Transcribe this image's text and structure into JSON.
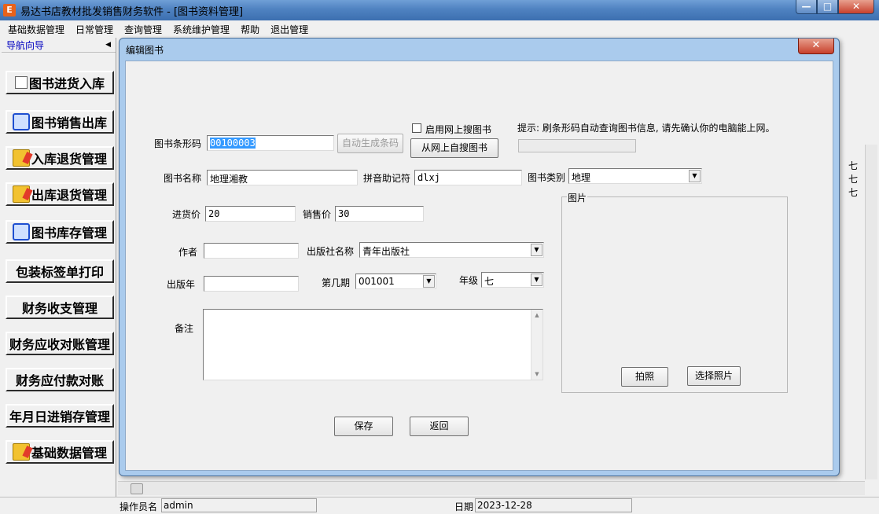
{
  "window": {
    "title": "易达书店教材批发销售财务软件    - [图书资料管理]",
    "app_icon": "e-icon"
  },
  "menubar": [
    "基础数据管理",
    "日常管理",
    "查询管理",
    "系统维护管理",
    "帮助",
    "退出管理"
  ],
  "sidebar": {
    "header": "导航向导",
    "items": [
      {
        "label": "图书进货入库",
        "icon": "cart-icon"
      },
      {
        "label": "图书销售出库",
        "icon": "arrows-icon"
      },
      {
        "label": "入库退货管理",
        "icon": "folder-icon"
      },
      {
        "label": "出库退货管理",
        "icon": "folder-icon"
      },
      {
        "label": "图书库存管理",
        "icon": "arrows-icon"
      },
      {
        "label": "包装标签单打印",
        "icon": ""
      },
      {
        "label": "财务收支管理",
        "icon": ""
      },
      {
        "label": "财务应收对账管理",
        "icon": ""
      },
      {
        "label": "财务应付款对账",
        "icon": ""
      },
      {
        "label": "年月日进销存管理",
        "icon": ""
      },
      {
        "label": "基础数据管理",
        "icon": "folder-icon"
      }
    ]
  },
  "background_grid": {
    "cells": [
      "七",
      "七",
      "七"
    ]
  },
  "dialog": {
    "title": "编辑图书",
    "barcode_label": "图书条形码",
    "barcode_value": "00100003",
    "auto_barcode_button": "自动生成条码",
    "online_search_checkbox": "启用网上搜图书",
    "online_search_checked": false,
    "online_search_button": "从网上自搜图书",
    "hint": "提示: 刷条形码自动查询图书信息, 请先确认你的电脑能上网。",
    "name_label": "图书名称",
    "name_value": "地理湘教",
    "pinyin_label": "拼音助记符",
    "pinyin_value": "dlxj",
    "category_label": "图书类别",
    "category_value": "地理",
    "purchase_price_label": "进货价",
    "purchase_price_value": "20",
    "sale_price_label": "销售价",
    "sale_price_value": "30",
    "author_label": "作者",
    "author_value": "",
    "publisher_label": "出版社名称",
    "publisher_value": "青年出版社",
    "pub_year_label": "出版年",
    "pub_year_value": "",
    "issue_label": "第几期",
    "issue_value": "001001",
    "grade_label": "年级",
    "grade_value": "七",
    "notes_label": "备注",
    "notes_value": "",
    "picture_group_label": "图片",
    "photo_button": "拍照",
    "choose_photo_button": "选择照片",
    "save_button": "保存",
    "back_button": "返回"
  },
  "statusbar": {
    "operator_label": "操作员名",
    "operator_value": "admin",
    "date_label": "日期",
    "date_value": "2023-12-28"
  }
}
